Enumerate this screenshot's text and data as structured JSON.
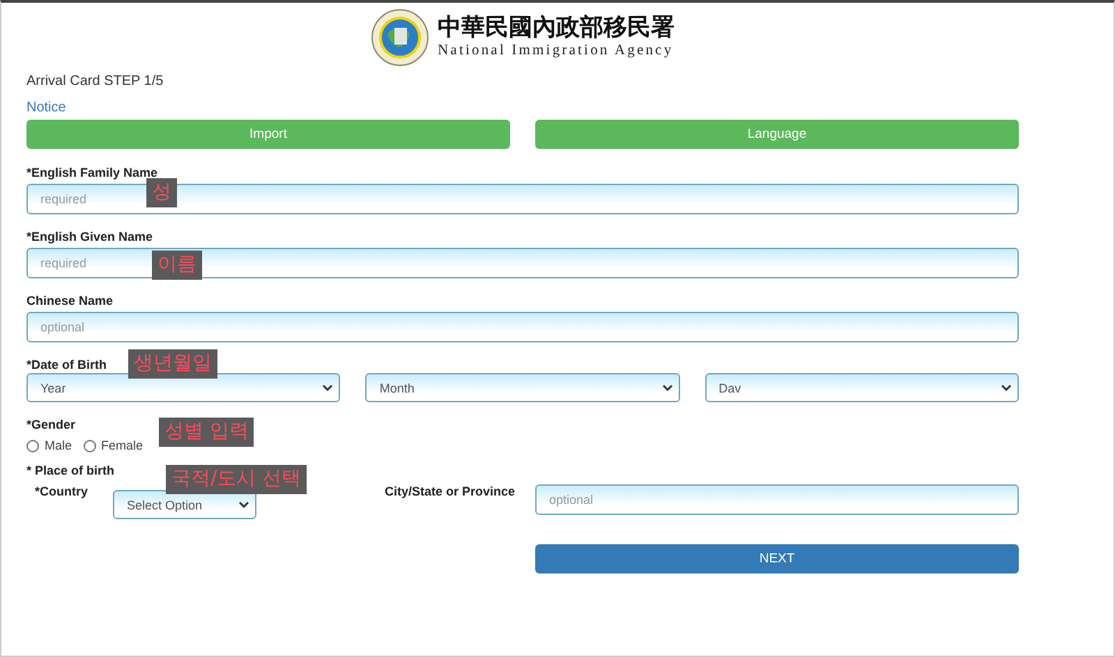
{
  "header": {
    "title": "中華民國內政部移民署",
    "subtitle": "National Immigration Agency"
  },
  "step": "Arrival Card STEP 1/5",
  "notice": "Notice",
  "top_buttons": [
    "Import",
    "Language"
  ],
  "text_fields": [
    {
      "label": "*English Family Name",
      "placeholder": "required",
      "annotation": "성"
    },
    {
      "label": "*English Given Name",
      "placeholder": "required",
      "annotation": "이름"
    },
    {
      "label": "Chinese Name",
      "placeholder": "optional"
    }
  ],
  "date_of_birth": {
    "label": "*Date of Birth",
    "annotation": "생년월일",
    "selects": [
      "Year",
      "Month",
      "Dav"
    ]
  },
  "gender": {
    "label": "*Gender",
    "annotation": "성별 입력",
    "options": [
      {
        "label": "Male",
        "selected": false
      },
      {
        "label": "Female",
        "selected": false
      }
    ]
  },
  "place_of_birth": {
    "label": "* Place of birth",
    "country_label": "*Country",
    "country_value": "Select Option",
    "annotation": "국적/도시 선택",
    "city_label": "City/State or Province",
    "city_placeholder": "optional"
  },
  "next_button": "NEXT"
}
